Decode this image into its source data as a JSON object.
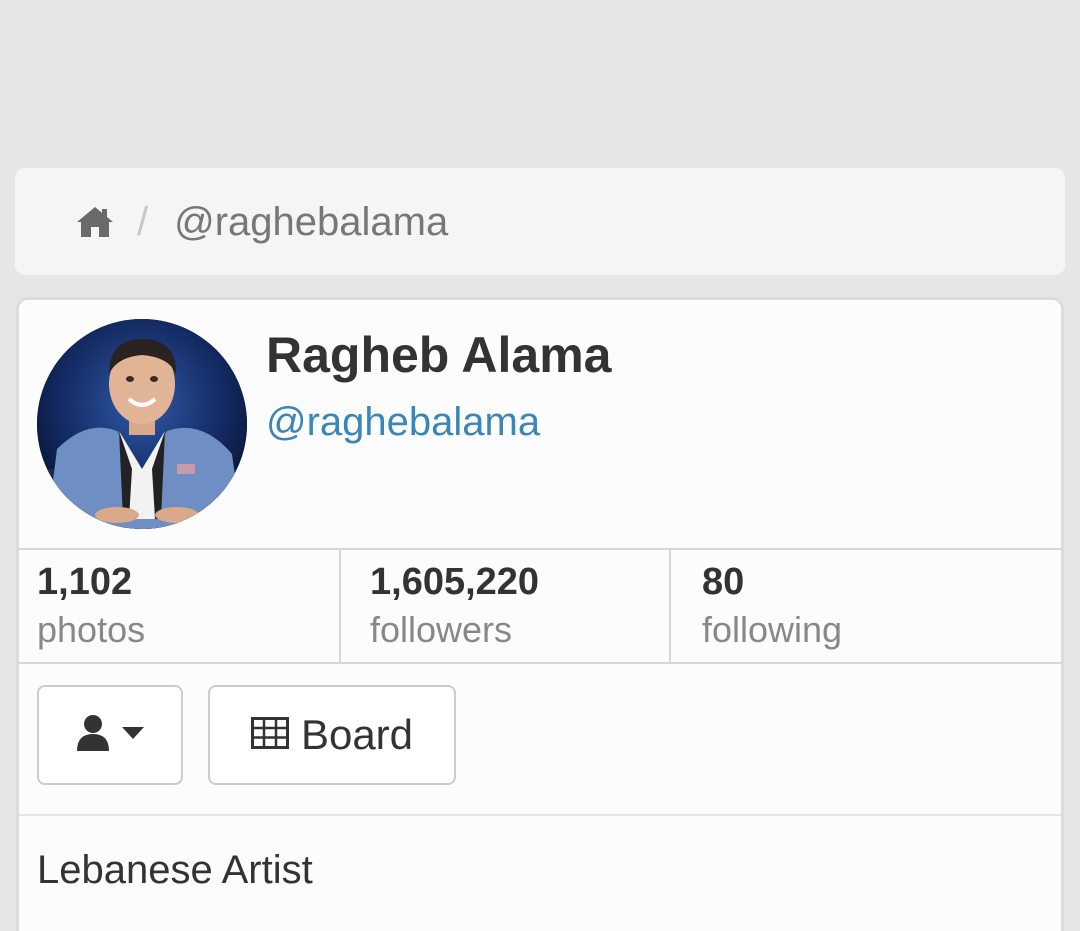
{
  "breadcrumb": {
    "home_icon": "home-icon",
    "separator": "/",
    "current": "@raghebalama"
  },
  "profile": {
    "name": "Ragheb Alama",
    "handle": "@raghebalama",
    "avatar": "profile-photo",
    "bio": "Lebanese Artist"
  },
  "stats": [
    {
      "value": "1,102",
      "label": "photos"
    },
    {
      "value": "1,605,220",
      "label": "followers"
    },
    {
      "value": "80",
      "label": "following"
    }
  ],
  "actions": {
    "user_menu_icon": "user-icon",
    "dropdown_icon": "caret-down-icon",
    "board_icon": "table-icon",
    "board_label": "Board"
  },
  "colors": {
    "background": "#e6e6e6",
    "link": "#3a86b8",
    "text": "#333333",
    "muted": "#888888"
  }
}
